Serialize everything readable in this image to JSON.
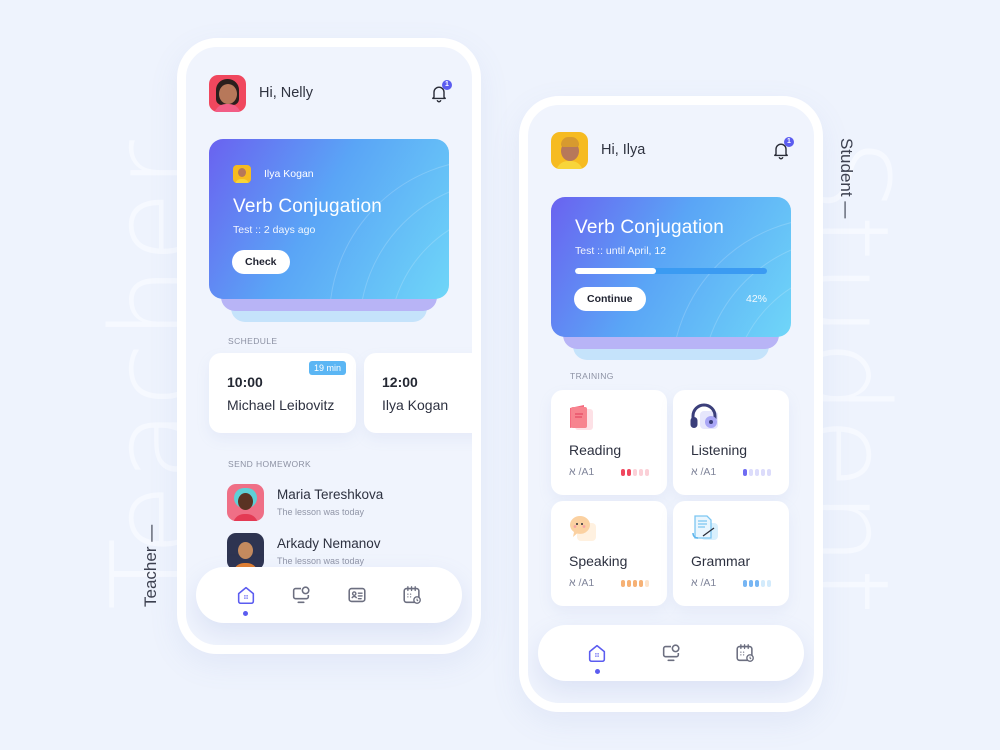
{
  "labels": {
    "teacher_bg": "Teacher",
    "student_bg": "Student",
    "teacher_side": "Teacher —",
    "student_side": "Student —"
  },
  "teacher": {
    "greeting": "Hi, Nelly",
    "notification_count": "1",
    "hero": {
      "author": "Ilya Kogan",
      "title": "Verb Conjugation",
      "subtitle": "Test :: 2 days ago",
      "button": "Check"
    },
    "schedule_label": "SCHEDULE",
    "schedule": [
      {
        "time": "10:00",
        "name": "Michael Leibovitz",
        "badge": "19 min"
      },
      {
        "time": "12:00",
        "name": "Ilya Kogan"
      }
    ],
    "homework_label": "SEND HOMEWORK",
    "homework": [
      {
        "name": "Maria Tereshkova",
        "subtitle": "The lesson was today"
      },
      {
        "name": "Arkady Nemanov",
        "subtitle": "The lesson was today"
      }
    ],
    "nav": [
      {
        "icon": "home-icon",
        "active": true
      },
      {
        "icon": "monitor-chat-icon",
        "active": false
      },
      {
        "icon": "id-card-icon",
        "active": false
      },
      {
        "icon": "calendar-clock-icon",
        "active": false
      }
    ]
  },
  "student": {
    "greeting": "Hi, Ilya",
    "notification_count": "1",
    "hero": {
      "title": "Verb Conjugation",
      "subtitle": "Test :: until April, 12",
      "button": "Continue",
      "progress_percent": 42,
      "progress_label": "42%"
    },
    "training_label": "TRAINING",
    "training": [
      {
        "name": "Reading",
        "level": "א /A1",
        "icon": "book-icon",
        "filled": 2,
        "total": 5,
        "color": "#f0475e",
        "light": "#fbd0d7"
      },
      {
        "name": "Listening",
        "level": "א /A1",
        "icon": "headphones-icon",
        "filled": 1,
        "total": 5,
        "color": "#6f6cf2",
        "light": "#dcdcfb"
      },
      {
        "name": "Speaking",
        "level": "א /A1",
        "icon": "speech-bubble-icon",
        "filled": 4,
        "total": 5,
        "color": "#f6b175",
        "light": "#fde4cc"
      },
      {
        "name": "Grammar",
        "level": "א /A1",
        "icon": "document-pen-icon",
        "filled": 3,
        "total": 5,
        "color": "#77b6f4",
        "light": "#d3ebfc"
      }
    ],
    "nav": [
      {
        "icon": "home-icon",
        "active": true
      },
      {
        "icon": "monitor-chat-icon",
        "active": false
      },
      {
        "icon": "calendar-clock-icon",
        "active": false
      }
    ]
  },
  "colors": {
    "accent": "#5b5cf0",
    "background": "#eef3fd",
    "badge_blue": "#5bb6f4"
  }
}
